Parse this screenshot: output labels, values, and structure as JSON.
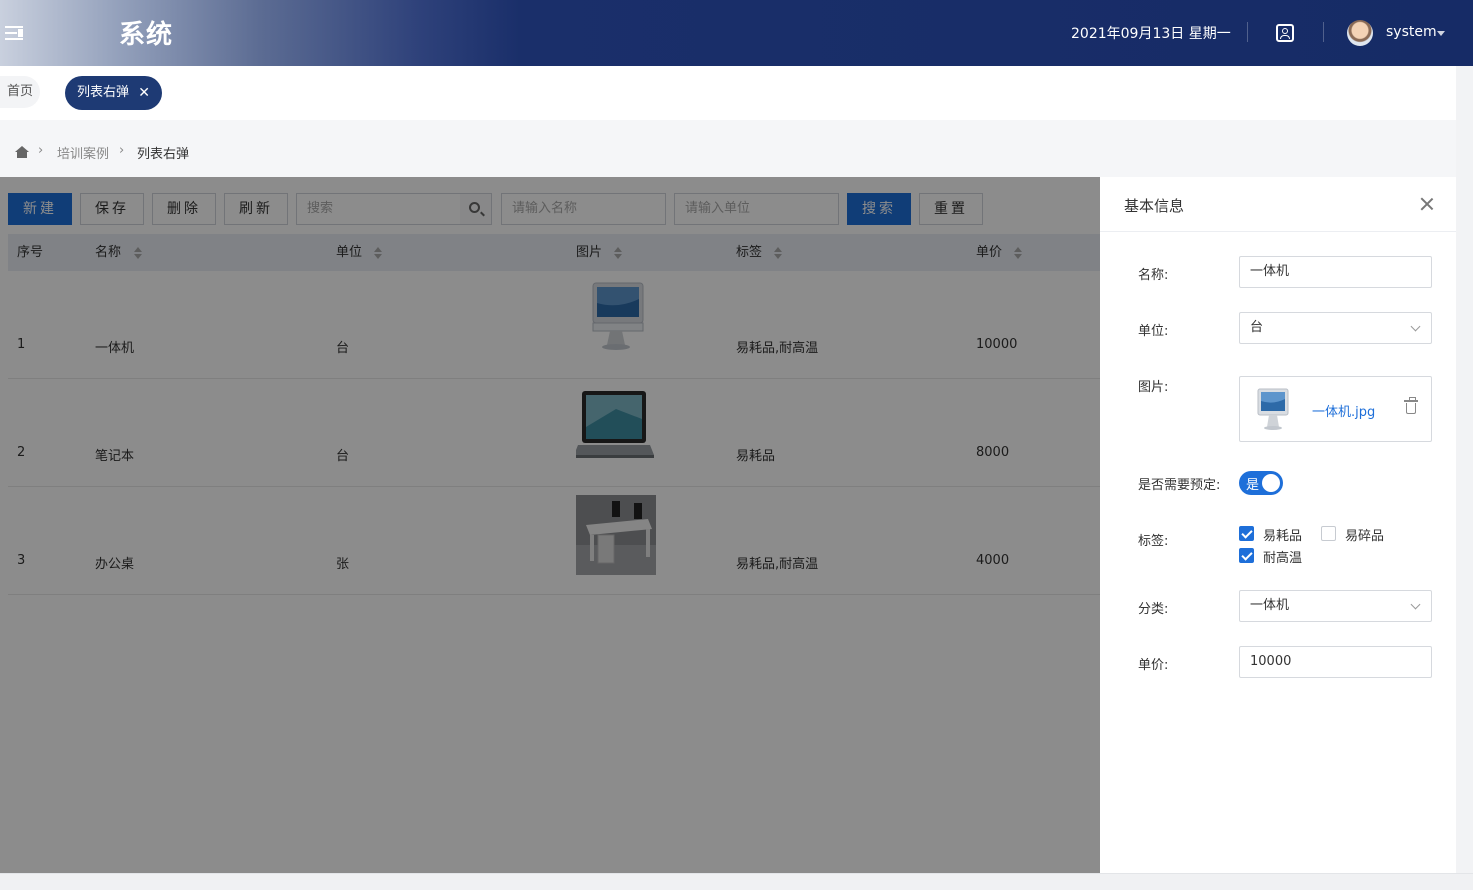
{
  "header": {
    "title": "系统",
    "date": "2021年09月13日 星期一",
    "user": "system"
  },
  "tabs": {
    "home": "首页",
    "active": "列表右弹",
    "close": "✕"
  },
  "breadcrumb": {
    "items": [
      "培训案例",
      "列表右弹"
    ],
    "separator": "›"
  },
  "toolbar": {
    "new": "新建",
    "save": "保存",
    "delete": "删除",
    "refresh": "刷新",
    "search_placeholder": "搜索",
    "name_placeholder": "请输入名称",
    "unit_placeholder": "请输入单位",
    "search_btn": "搜索",
    "reset": "重置"
  },
  "table": {
    "columns": [
      "序号",
      "名称",
      "单位",
      "图片",
      "标签",
      "单价"
    ],
    "rows": [
      {
        "index": "1",
        "name": "一体机",
        "unit": "台",
        "image": "imac-image",
        "tags": "易耗品,耐高温",
        "price": "10000"
      },
      {
        "index": "2",
        "name": "笔记本",
        "unit": "台",
        "image": "laptop-image",
        "tags": "易耗品",
        "price": "8000"
      },
      {
        "index": "3",
        "name": "办公桌",
        "unit": "张",
        "image": "desk-image",
        "tags": "易耗品,耐高温",
        "price": "4000"
      }
    ]
  },
  "drawer": {
    "title": "基本信息",
    "fields": {
      "name_label": "名称:",
      "name_value": "一体机",
      "unit_label": "单位:",
      "unit_value": "台",
      "image_label": "图片:",
      "image_file": "一体机.jpg",
      "booking_label": "是否需要预定:",
      "booking_value": "是",
      "tags_label": "标签:",
      "tag_options": [
        {
          "label": "易耗品",
          "checked": true
        },
        {
          "label": "易碎品",
          "checked": false
        },
        {
          "label": "耐高温",
          "checked": true
        }
      ],
      "category_label": "分类:",
      "category_value": "一体机",
      "price_label": "单价:",
      "price_value": "10000"
    }
  },
  "colors": {
    "header": "#162b66",
    "primary": "#1e6fd9",
    "active_tab": "#1e3a74"
  }
}
